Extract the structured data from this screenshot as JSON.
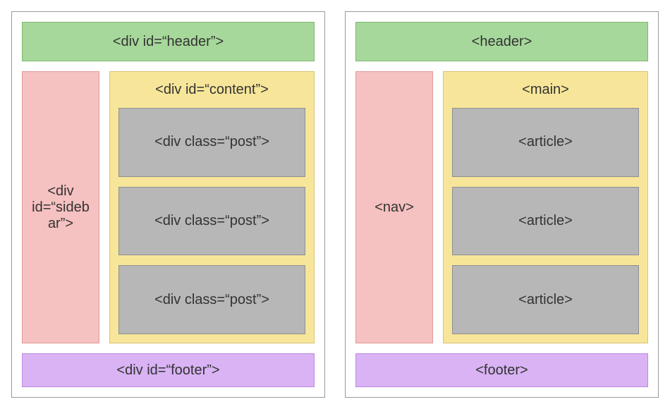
{
  "left": {
    "header": "<div id=“header”>",
    "sidebar": "<div id=“sidebar”>",
    "content": "<div id=“content”>",
    "posts": [
      "<div class=“post”>",
      "<div class=“post”>",
      "<div class=“post”>"
    ],
    "footer": "<div id=“footer”>"
  },
  "right": {
    "header": "<header>",
    "sidebar": "<nav>",
    "content": "<main>",
    "posts": [
      "<article>",
      "<article>",
      "<article>"
    ],
    "footer": "<footer>"
  },
  "colors": {
    "header": "#a7d89b",
    "sidebar": "#f6c1c1",
    "content": "#f7e69a",
    "post": "#b7b7b7",
    "footer": "#d9b3f4"
  }
}
